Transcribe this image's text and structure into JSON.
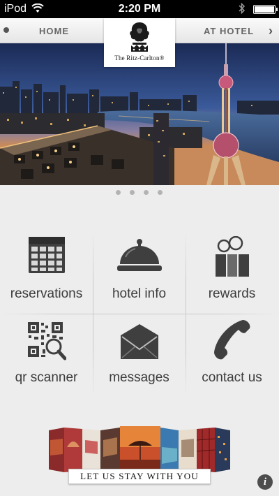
{
  "status_bar": {
    "carrier": "iPod",
    "time": "2:20 PM"
  },
  "nav": {
    "home_label": "HOME",
    "at_hotel_label": "AT HOTEL"
  },
  "logo": {
    "text": "The Ritz-Carlton®"
  },
  "hero": {
    "page_count": 4,
    "active_page": 1
  },
  "menu": {
    "reservations": "reservations",
    "hotel_info": "hotel info",
    "rewards": "rewards",
    "qr_scanner": "qr scanner",
    "messages": "messages",
    "contact_us": "contact us"
  },
  "banner": {
    "tagline": "LET US STAY WITH YOU"
  },
  "colors": {
    "icon": "#3f3f3f",
    "label": "#3c3c3c",
    "background": "#ededed"
  }
}
